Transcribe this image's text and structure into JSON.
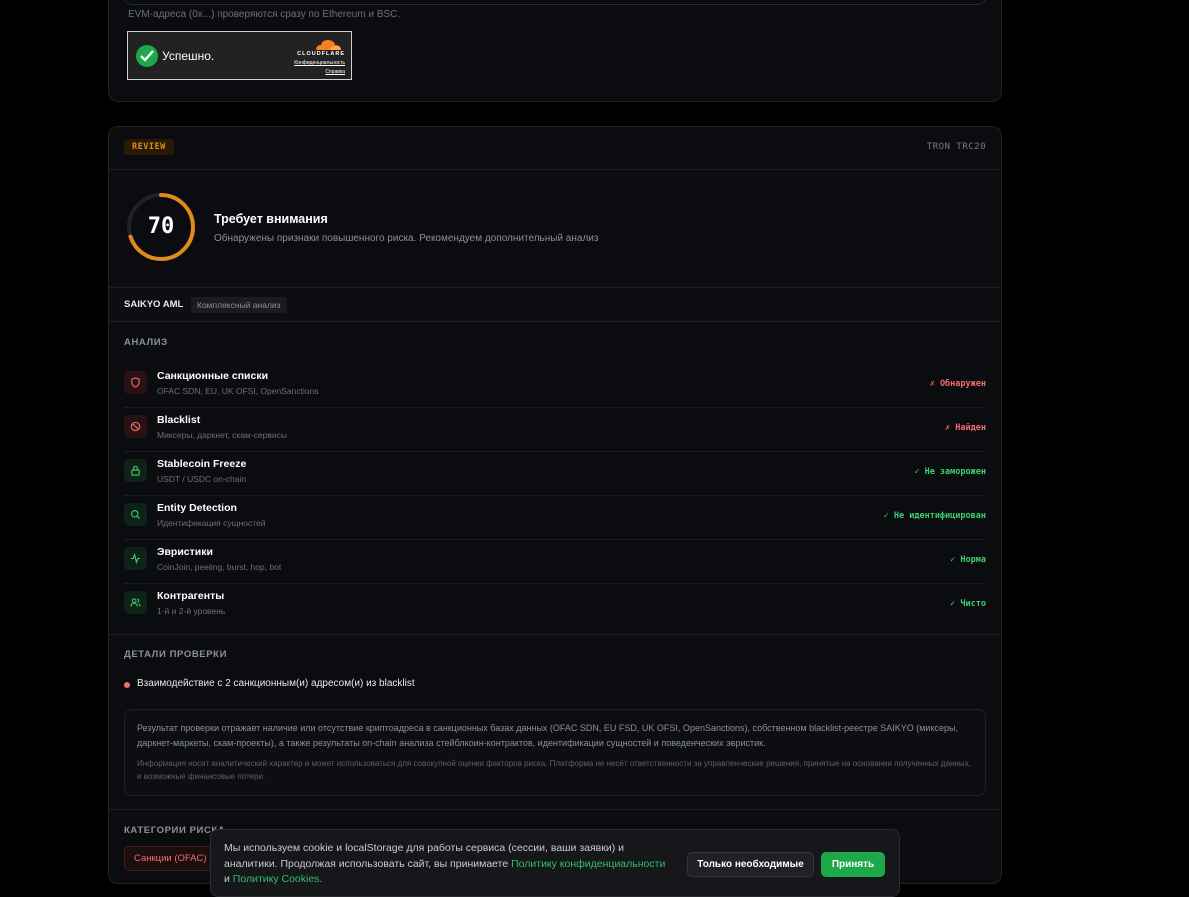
{
  "address_form": {
    "hint": "EVM-адреса (0x...) проверяются сразу по Ethereum и BSC."
  },
  "captcha": {
    "status": "Успешно.",
    "brand": "CLOUDFLARE",
    "privacy_link": "Конфиденциальность",
    "help_link": "Справка"
  },
  "result": {
    "badge": "REVIEW",
    "network": "TRON TRC20",
    "score": "70",
    "score_fraction": 0.7,
    "verdict_title": "Требует внимания",
    "verdict_subtitle": "Обнаружены признаки повышенного риска. Рекомендуем дополнительный анализ",
    "provider": "SAIKYO AML",
    "provider_tag": "Комплексный анализ",
    "colors": {
      "accent_warning": "#e08a1a",
      "danger": "#f26d6d",
      "success": "#3ccf6e"
    }
  },
  "analysis": {
    "title": "АНАЛИЗ",
    "checks": [
      {
        "name": "Санкционные списки",
        "desc": "OFAC SDN, EU, UK OFSI, OpenSanctions",
        "status": "✗ Обнаружен",
        "icon": "shield-icon",
        "state": "bad"
      },
      {
        "name": "Blacklist",
        "desc": "Миксеры, даркнет, скам-сервисы",
        "status": "✗ Найден",
        "icon": "ban-icon",
        "state": "bad"
      },
      {
        "name": "Stablecoin Freeze",
        "desc": "USDT / USDC on-chain",
        "status": "✓ Не заморожен",
        "icon": "lock-icon",
        "state": "ok"
      },
      {
        "name": "Entity Detection",
        "desc": "Идентификация сущностей",
        "status": "✓ Не идентифицирован",
        "icon": "search-icon",
        "state": "ok"
      },
      {
        "name": "Эвристики",
        "desc": "CoinJoin, peeling, burst, hop, bot",
        "status": "✓ Норма",
        "icon": "activity-icon",
        "state": "ok"
      },
      {
        "name": "Контрагенты",
        "desc": "1-й и 2-й уровень",
        "status": "✓ Чисто",
        "icon": "users-icon",
        "state": "ok"
      }
    ]
  },
  "details": {
    "title": "ДЕТАЛИ ПРОВЕРКИ",
    "item": "Взаимодействие с 2 санкционным(и) адресом(и) из blacklist",
    "disclaimer_main": "Результат проверки отражает наличие или отсутствие криптоадреса в санкционных базах данных (OFAC SDN, EU FSD, UK OFSI, OpenSanctions), собственном blacklist-реестре SAIKYO (миксеры, даркнет-маркеты, скам-проекты), а также результаты on-chain анализа стейблкоин-контрактов, идентификации сущностей и поведенческих эвристик.",
    "disclaimer_small": "Информация носит аналитический характер и может использоваться для совокупной оценки факторов риска. Платформа не несёт ответственности за управленческие решения, принятые на основании полученных данных, и возможные финансовые потери."
  },
  "categories": {
    "title": "КАТЕГОРИИ РИСКА",
    "items": [
      "Санкции (OFAC)"
    ]
  },
  "cookie": {
    "text_before": "Мы используем cookie и localStorage для работы сервиса (сессии, ваши заявки) и аналитики. Продолжая использовать сайт, вы принимаете ",
    "privacy_link": "Политику конфиденциальности",
    "and": " и ",
    "cookies_link": "Политику Cookies.",
    "essential_button": "Только необходимые",
    "accept_button": "Принять"
  }
}
